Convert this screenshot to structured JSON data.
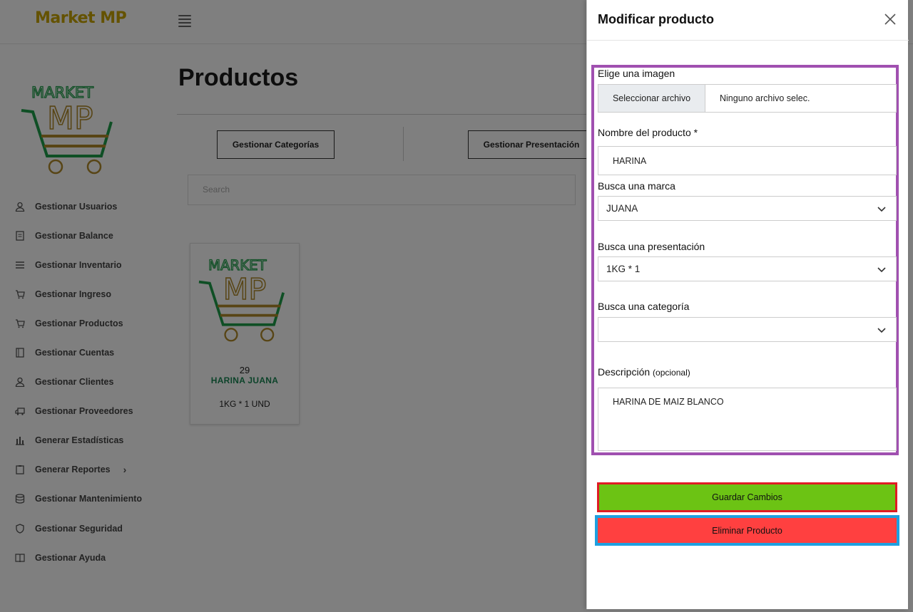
{
  "app": {
    "brand": "Market MP",
    "logo_text_top": "MARKET",
    "logo_text_bottom": "MP"
  },
  "colors": {
    "brand": "#c9a400",
    "logo_green": "#1f9e4a",
    "logo_gold": "#b08a2a",
    "highlight_purple": "#a050b0",
    "highlight_red": "#e01b24",
    "highlight_blue": "#1ea0e0",
    "save_green": "#6cc314",
    "delete_red": "#ff4040"
  },
  "sidebar": {
    "items": [
      {
        "label": "Gestionar Usuarios",
        "icon": "user-icon"
      },
      {
        "label": "Gestionar Balance",
        "icon": "document-icon"
      },
      {
        "label": "Gestionar Inventario",
        "icon": "list-icon"
      },
      {
        "label": "Gestionar Ingreso",
        "icon": "cart-icon"
      },
      {
        "label": "Gestionar Productos",
        "icon": "cart-icon"
      },
      {
        "label": "Gestionar Cuentas",
        "icon": "book-icon"
      },
      {
        "label": "Gestionar Clientes",
        "icon": "user-icon"
      },
      {
        "label": "Gestionar Proveedores",
        "icon": "truck-icon"
      },
      {
        "label": "Generar Estadísticas",
        "icon": "bar-chart-icon"
      },
      {
        "label": "Generar Reportes",
        "icon": "clipboard-icon",
        "has_submenu": true
      },
      {
        "label": "Gestionar Mantenimiento",
        "icon": "database-icon"
      },
      {
        "label": "Gestionar Seguridad",
        "icon": "shield-icon"
      },
      {
        "label": "Gestionar Ayuda",
        "icon": "open-book-icon"
      }
    ]
  },
  "main": {
    "title": "Productos",
    "buttons": {
      "categories": "Gestionar Categorías",
      "presentation": "Gestionar Presentación"
    },
    "search_placeholder": "Search",
    "product_card": {
      "id": "29",
      "name": "HARINA JUANA",
      "presentation": "1KG * 1 UND"
    }
  },
  "panel": {
    "title": "Modificar producto",
    "image_label": "Elige una imagen",
    "file_button": "Seleccionar archivo",
    "file_status": "Ninguno archivo selec.",
    "name_label": "Nombre del producto *",
    "name_value": "HARINA",
    "brand_label": "Busca una marca",
    "brand_value": "JUANA",
    "presentation_label": "Busca una presentación",
    "presentation_value": "1KG * 1",
    "category_label": "Busca una categoría",
    "category_value": "",
    "description_label": "Descripción",
    "description_optional": "(opcional)",
    "description_value": "HARINA DE MAIZ BLANCO",
    "save_button": "Guardar Cambios",
    "delete_button": "Eliminar Producto"
  }
}
